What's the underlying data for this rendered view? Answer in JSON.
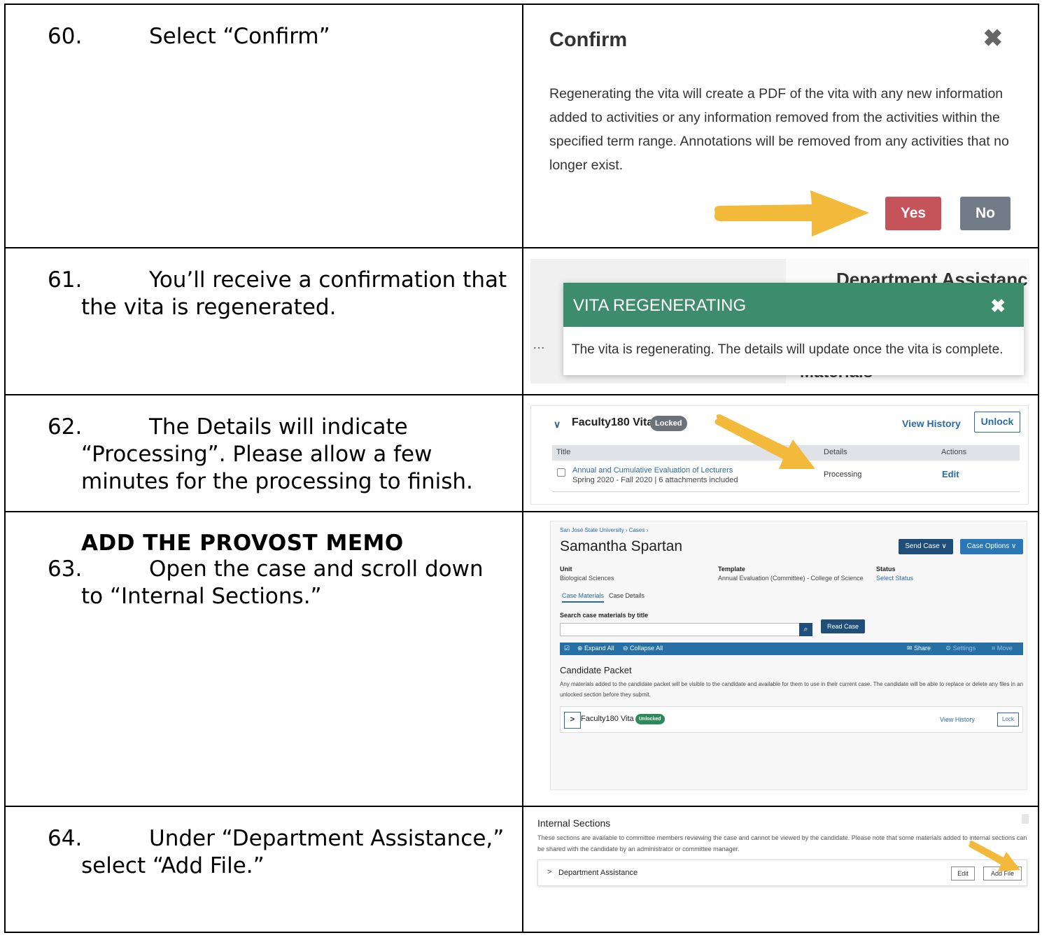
{
  "steps": [
    {
      "num": "60.",
      "text": "Select “Confirm”"
    },
    {
      "num": "61.",
      "text": "You’ll receive a confirmation that the vita is regenerated."
    },
    {
      "num": "62.",
      "text": "The Details will indicate “Processing”. Please allow a few minutes for the processing to finish."
    },
    {
      "num": "63.",
      "text": "Open the case and scroll down to “Internal Sections.”"
    },
    {
      "num": "64.",
      "text": "Under “Department Assistance,” select “Add File.”"
    }
  ],
  "section_heading": "ADD THE PROVOST MEMO",
  "confirm_modal": {
    "title": "Confirm",
    "close_glyph": "✖",
    "body": "Regenerating the vita will create a PDF of the vita with any new information added to activities or any information removed from the activities within the specified term range. Annotations will be removed from any activities that no longer exist.",
    "yes_label": "Yes",
    "no_label": "No",
    "yes_color": "#c4535a",
    "no_color": "#707b87"
  },
  "regen_toast": {
    "bg_heading": "Department Assistanc",
    "bg_materials": "Materials",
    "dots": "…",
    "title": "VITA REGENERATING",
    "close_glyph": "✖",
    "message": "The vita is regenerating. The details will update once the vita is complete.",
    "header_color": "#3e8c6e"
  },
  "vita_panel": {
    "chevron": "∨",
    "name": "Faculty180 Vita",
    "badge": "Locked",
    "view_history": "View History",
    "unlock": "Unlock",
    "col_title": "Title",
    "col_details": "Details",
    "col_actions": "Actions",
    "row_title": "Annual and Cumulative Evaluation of Lecturers",
    "row_sub": "Spring 2020 - Fall 2020 | 6 attachments included",
    "row_details": "Processing",
    "row_edit": "Edit"
  },
  "case_page": {
    "breadcrumb": "San José State University  ›  Cases  ›",
    "title": "Samantha Spartan",
    "send_case": "Send Case ∨",
    "case_options": "Case Options ∨",
    "unit_label": "Unit",
    "unit_value": "Biological Sciences",
    "template_label": "Template",
    "template_value": "Annual Evaluation (Committee) - College of Science",
    "status_label": "Status",
    "status_value": "Select Status",
    "tab_materials": "Case Materials",
    "tab_details": "Case Details",
    "search_label": "Search case materials by title",
    "search_icon": "⌕",
    "read_case": "Read Case",
    "bar_checkbox": "☑",
    "expand_all": "⊕ Expand All",
    "collapse_all": "⊖ Collapse All",
    "share": "✉ Share",
    "settings": "⚙ Settings",
    "move": "≡ Move",
    "candidate_packet_title": "Candidate Packet",
    "candidate_packet_desc": "Any materials added to the candidate packet will be visible to the candidate and available for them to use in their current case. The candidate will be able to replace or delete any files in an unlocked section before they submit.",
    "vita_expand": ">",
    "vita_name": "Faculty180 Vita",
    "vita_badge": "Unlocked",
    "vita_view_history": "View History",
    "vita_lock": "Lock"
  },
  "internal_sections": {
    "title": "Internal Sections",
    "desc": "These sections are available to committee members reviewing the case and cannot be viewed by the candidate. Please note that some materials added to internal sections can be shared with the candidate by an administrator or committee manager.",
    "chevron": ">",
    "dept_name": "Department Assistance",
    "edit": "Edit",
    "add_file": "Add File"
  },
  "colors": {
    "arrow": "#f2b93b",
    "accent_blue": "#2a6aa8"
  }
}
